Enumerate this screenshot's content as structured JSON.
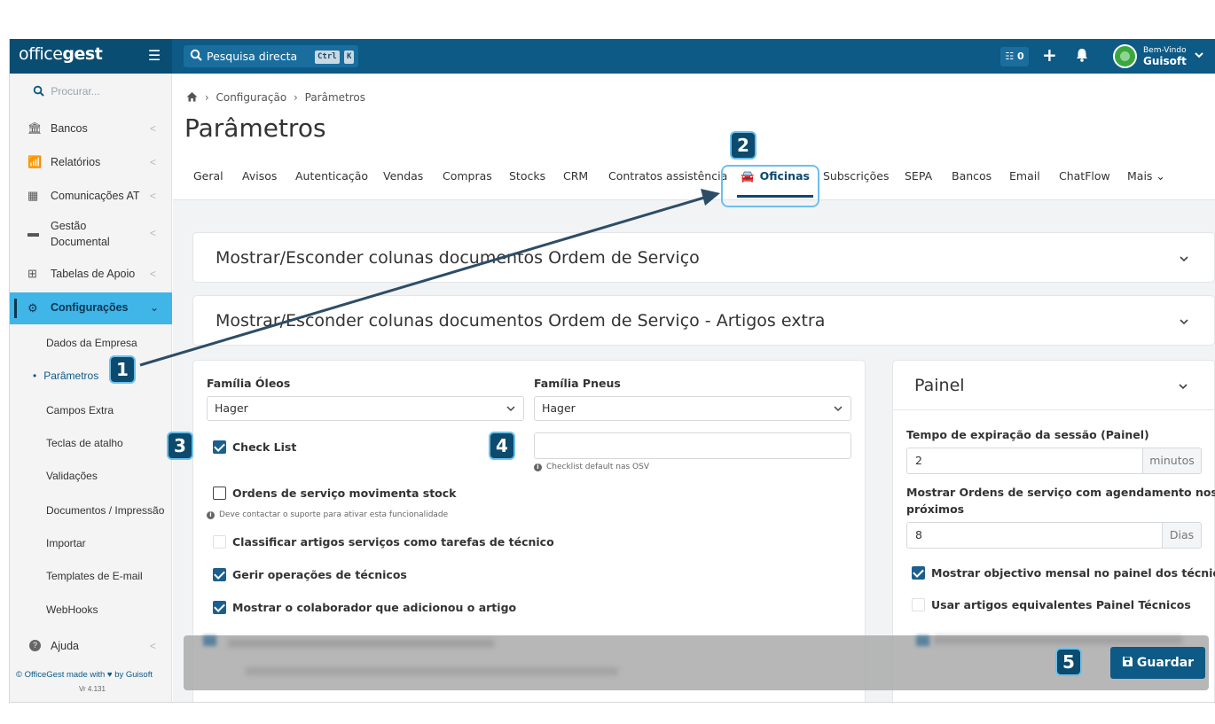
{
  "topbar": {
    "logo": {
      "part1": "office",
      "part2": "gest"
    },
    "search_text": "Pesquisa directa",
    "kbd1": "Ctrl",
    "kbd2": "K",
    "tasks_count": "0",
    "welcome": "Bem-Vindo",
    "username": "Guisoft",
    "icons": [
      "menu-icon",
      "search-icon",
      "tasks-icon",
      "plus-icon",
      "bell-icon",
      "avatar",
      "chevron-down-icon"
    ]
  },
  "sidebar": {
    "search_placeholder": "Procurar...",
    "items": [
      {
        "label": "Bancos",
        "icon": "bank-icon"
      },
      {
        "label": "Relatórios",
        "icon": "chart-icon"
      },
      {
        "label": "Comunicações AT",
        "icon": "building-icon"
      },
      {
        "label": "Gestão Documental",
        "label_line1": "Gestão",
        "label_line2": "Documental",
        "icon": "file-icon"
      },
      {
        "label": "Tabelas de Apoio",
        "icon": "table-icon"
      },
      {
        "label": "Configurações",
        "icon": "gears-icon"
      }
    ],
    "sub_items": [
      "Dados da Empresa",
      "Parâmetros",
      "Campos Extra",
      "Teclas de atalho",
      "Validações",
      "Documentos / Impressão",
      "Importar",
      "Templates de E-mail",
      "WebHooks"
    ],
    "help": "Ajuda",
    "footer": "© OfficeGest made with ♥ by Guisoft",
    "version": "Vr 4.131"
  },
  "breadcrumb": [
    "Configuração",
    "Parâmetros"
  ],
  "page_title": "Parâmetros",
  "tabs": [
    "Geral",
    "Avisos",
    "Autenticação",
    "Vendas",
    "Compras",
    "Stocks",
    "CRM",
    "Contratos assistência",
    "Oficinas",
    "Subscrições",
    "SEPA",
    "Bancos",
    "Email",
    "ChatFlow",
    "Mais"
  ],
  "active_tab": "Oficinas",
  "cards": {
    "card1_title": "Mostrar/Esconder colunas documentos Ordem de Serviço",
    "card2_title": "Mostrar/Esconder colunas documentos Ordem de Serviço - Artigos extra"
  },
  "oficinas": {
    "familia_oleos_label": "Família Óleos",
    "familia_oleos_value": "Hager",
    "familia_pneus_label": "Família Pneus",
    "familia_pneus_value": "Hager",
    "checklist_value": "",
    "checklist_help": "Checklist default nas OSV",
    "checkboxes": [
      {
        "label": "Check List",
        "checked": true
      },
      {
        "label": "Ordens de serviço movimenta stock",
        "checked": false
      },
      {
        "label": "Classificar artigos serviços como tarefas de técnico",
        "checked": false
      },
      {
        "label": "Gerir operações de técnicos",
        "checked": true
      },
      {
        "label": "Mostrar o colaborador que adicionou o artigo",
        "checked": true
      }
    ],
    "stock_help": "Deve contactar o suporte para ativar esta funcionalidade"
  },
  "painel": {
    "title": "Painel",
    "tempo_label": "Tempo de expiração da sessão (Painel)",
    "tempo_value": "2",
    "tempo_unit": "minutos",
    "agendamento_label_line1": "Mostrar Ordens de serviço com agendamento nos",
    "agendamento_label_line2": "próximos",
    "agendamento_value": "8",
    "agendamento_unit": "Dias",
    "checkboxes": [
      {
        "label": "Mostrar objectivo mensal no painel dos técnicos",
        "checked": true
      },
      {
        "label": "Usar artigos equivalentes Painel Técnicos",
        "checked": false
      }
    ]
  },
  "save_label": "Guardar",
  "callouts": [
    "1",
    "2",
    "3",
    "4",
    "5"
  ],
  "colors": {
    "primary": "#0c5a85",
    "accent": "#3fb5e8",
    "callout_border": "#6cc0ea"
  }
}
